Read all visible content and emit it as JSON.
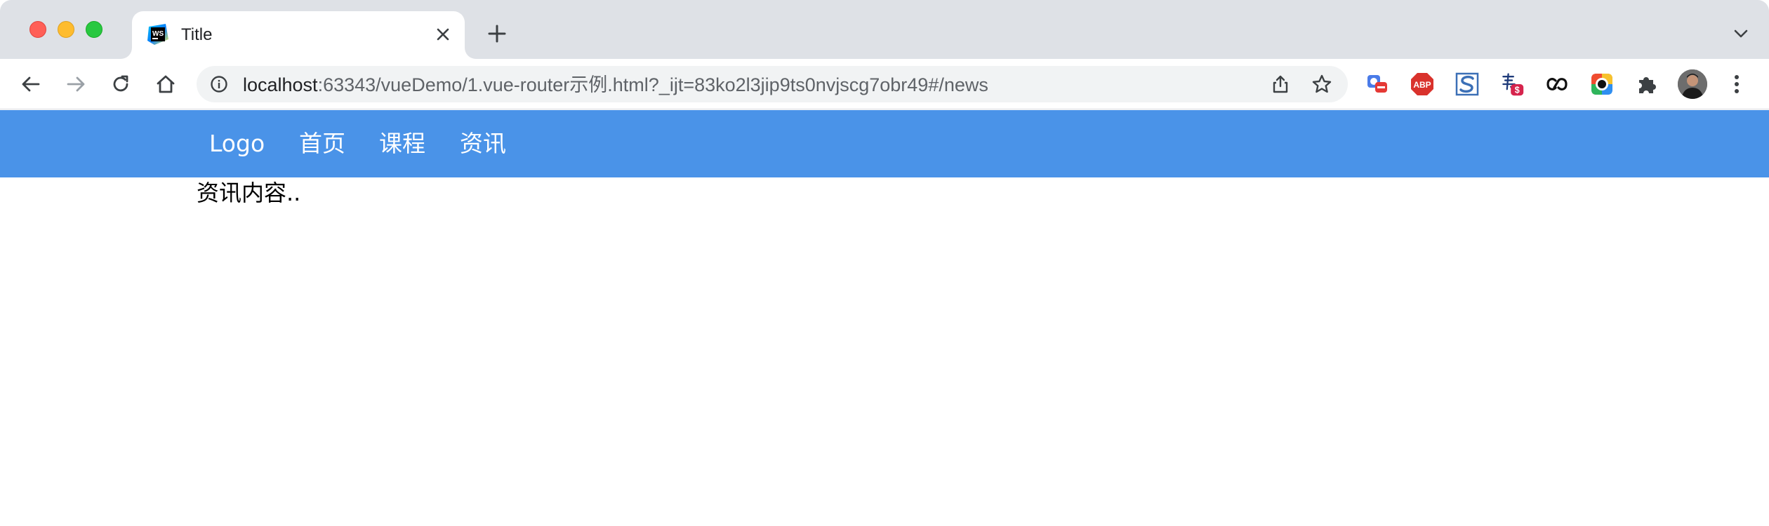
{
  "browser": {
    "tab": {
      "title": "Title",
      "favicon": "webstorm-icon"
    },
    "address_bar": {
      "host": "localhost",
      "path": ":63343/vueDemo/1.vue-router示例.html?_ijt=83ko2l3jip9ts0nvjscg7obr49#/news"
    },
    "extensions": [
      "translate-extension-icon",
      "adblock-plus-icon",
      "s-extension-icon",
      "money-extension-icon",
      "link-extension-icon",
      "color-extension-icon",
      "puzzle-icon"
    ],
    "abp_label": "ABP",
    "money_badge": "$"
  },
  "site_nav": {
    "items": [
      {
        "label": "Logo"
      },
      {
        "label": "首页"
      },
      {
        "label": "课程"
      },
      {
        "label": "资讯"
      }
    ]
  },
  "content": {
    "text": "资讯内容.."
  },
  "colors": {
    "nav_background": "#4a93e8",
    "tabstrip": "#dee1e6",
    "omnibox": "#f1f3f4"
  }
}
